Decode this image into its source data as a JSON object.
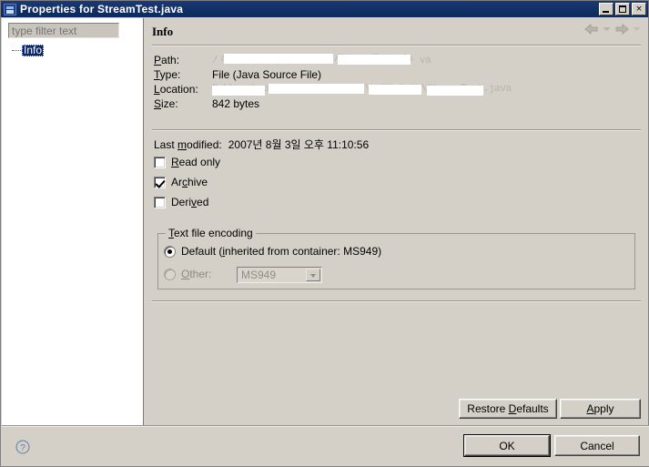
{
  "window": {
    "title": "Properties for StreamTest.java",
    "icon": "properties-window-icon",
    "minimize_label": "Minimize",
    "maximize_label": "Maximize",
    "close_label": "×"
  },
  "sidebar": {
    "filter_placeholder": "type filter text",
    "filter_value": "",
    "items": [
      {
        "label": "Info",
        "selected": true
      }
    ]
  },
  "main": {
    "title": "Info",
    "nav": {
      "back_label": "Back",
      "back_menu_label": "Back history",
      "forward_label": "Forward",
      "forward_menu_label": "Forward history"
    },
    "info_rows": [
      {
        "label": "Path:",
        "mnemonic": "P",
        "value": "",
        "redacted": true
      },
      {
        "label": "Type:",
        "mnemonic": "T",
        "value": "File  (Java Source File)",
        "redacted": false
      },
      {
        "label": "Location:",
        "mnemonic": "L",
        "value": "",
        "redacted": true
      },
      {
        "label": "Size:",
        "mnemonic": "S",
        "value": "842  bytes",
        "redacted": false
      }
    ],
    "last_modified_label": "Last modified:",
    "last_modified_value": "2007년 8월 3일 오후 11:10:56",
    "checkboxes": [
      {
        "label": "Read only",
        "checked": false
      },
      {
        "label": "Archive",
        "checked": true
      },
      {
        "label": "Derived",
        "checked": false
      }
    ],
    "encoding": {
      "group_label": "Text file encoding",
      "default_option": "Default (inherited from container: MS949)",
      "default_selected": true,
      "other_option": "Other:",
      "other_selected": false,
      "other_enabled": false,
      "combo_value": "MS949"
    },
    "buttons": {
      "restore_defaults": "Restore Defaults",
      "apply": "Apply"
    }
  },
  "footer": {
    "help_label": "?",
    "ok": "OK",
    "cancel": "Cancel"
  },
  "colors": {
    "titlebar": "#113067",
    "dialog_bg": "#d4d0c8",
    "tree_bg": "#ffffff",
    "selection": "#0a246a"
  }
}
